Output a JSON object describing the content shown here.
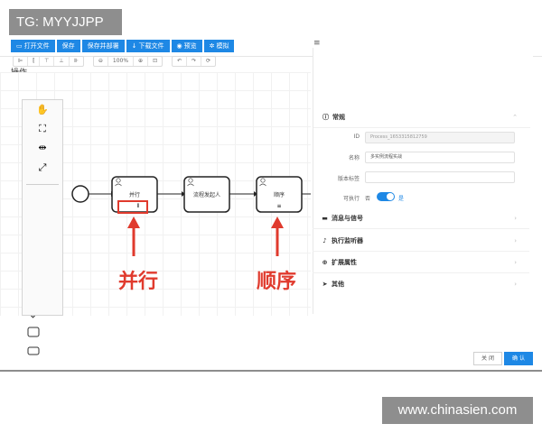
{
  "watermark_top": "TG: MYYJJPP",
  "watermark_bottom": "www.chinasien.com",
  "dialog": {
    "title": "操作",
    "close": "×"
  },
  "toolbar": {
    "buttons": [
      "打开文件",
      "保存",
      "保存并部署",
      "下载文件",
      "预览",
      "模拟"
    ],
    "zoom": "100%"
  },
  "diagram": {
    "task_parallel": "并行",
    "task_initiate": "流程发起人",
    "task_sequential": "顺序",
    "parallel_marker": "⦀",
    "sequential_marker": "≡"
  },
  "annotations": {
    "parallel": "并行",
    "sequential": "顺序"
  },
  "panel": {
    "menu_icon": "≡",
    "section_general": "常规",
    "id_label": "ID",
    "id_value": "Process_1653315812759",
    "name_label": "名称",
    "name_value": "多实例流程实战",
    "version_label": "版本标签",
    "version_value": "",
    "executable_label": "可执行",
    "toggle_off_text": "否",
    "toggle_on_text": "是",
    "section_messages": "消息与信号",
    "section_listeners": "执行监听器",
    "section_extensions": "扩展属性",
    "section_other": "其他"
  },
  "footer": {
    "cancel": "关 闭",
    "confirm": "确 认"
  },
  "colors": {
    "accent": "#1e88e5",
    "annotation": "#e03a2d",
    "watermark_bg": "#8e8e8e"
  }
}
